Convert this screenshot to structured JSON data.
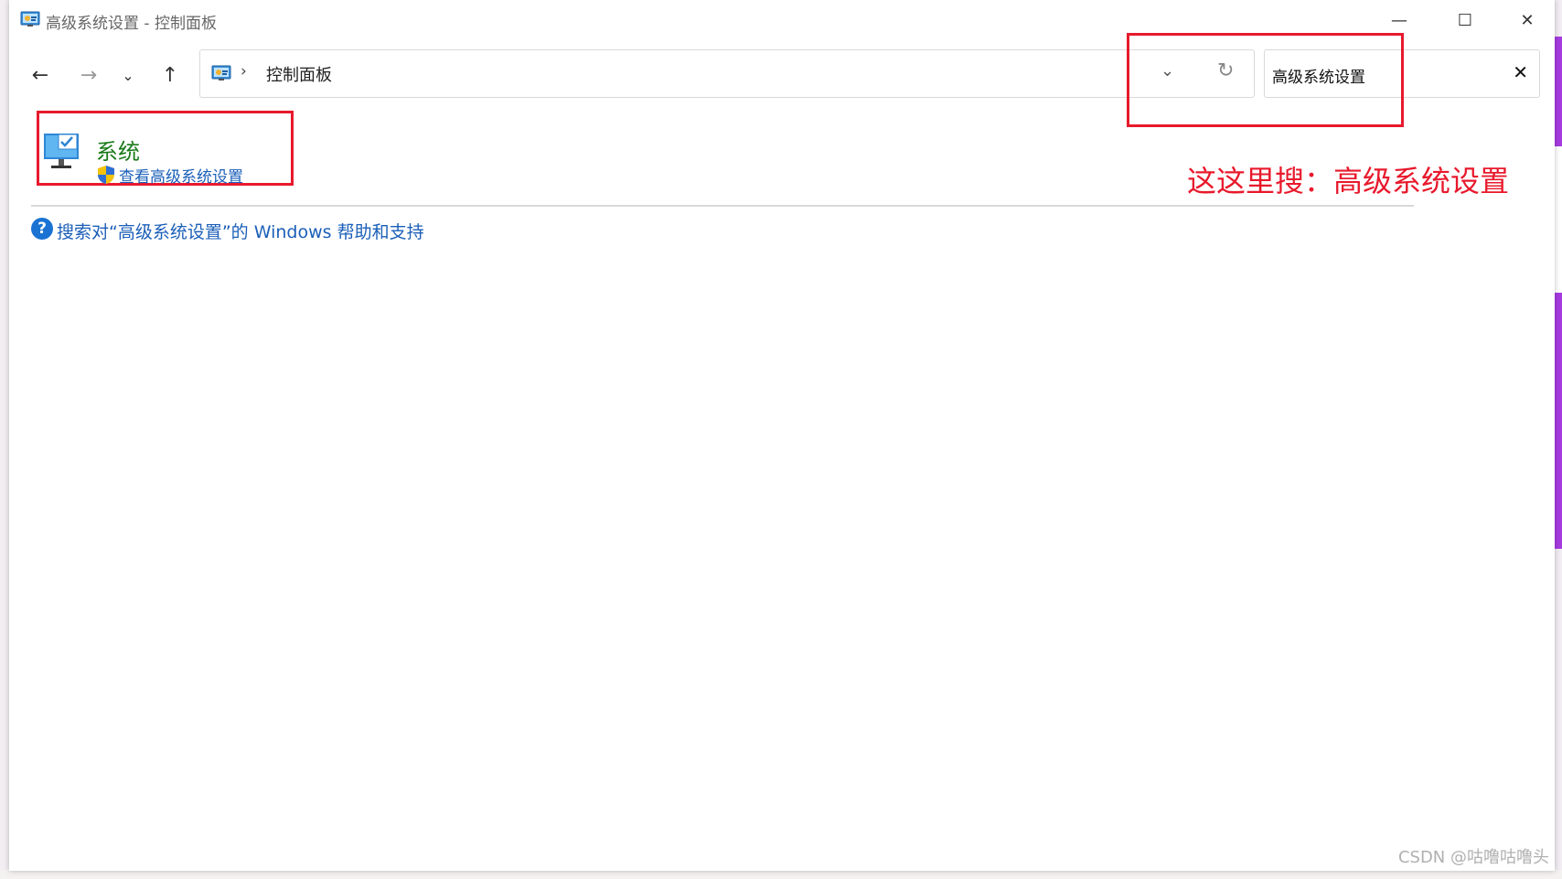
{
  "window": {
    "title": "高级系统设置 - 控制面板",
    "controls": {
      "minimize": "—",
      "maximize": "☐",
      "close": "✕"
    }
  },
  "nav": {
    "back_icon": "←",
    "forward_icon": "→",
    "recent_icon": "⌄",
    "up_icon": "↑",
    "address_separator": "›",
    "address_path": "控制面板",
    "dropdown_icon": "⌄",
    "refresh_icon": "↻"
  },
  "search": {
    "value": "高级系统设置",
    "clear_icon": "✕"
  },
  "annotation": {
    "text": "这这里搜：高级系统设置",
    "color": "#e8192c"
  },
  "results": [
    {
      "title": "系统",
      "link": "查看高级系统设置",
      "icon": "computer-icon",
      "link_icon": "uac-shield-icon"
    }
  ],
  "help": {
    "icon": "?",
    "text": "搜索对“高级系统设置”的 Windows 帮助和支持"
  },
  "watermark": "CSDN @咕噜咕噜头",
  "colors": {
    "link": "#1b5fb8",
    "title_green": "#1a7a1a",
    "highlight_red": "#e8192c"
  }
}
